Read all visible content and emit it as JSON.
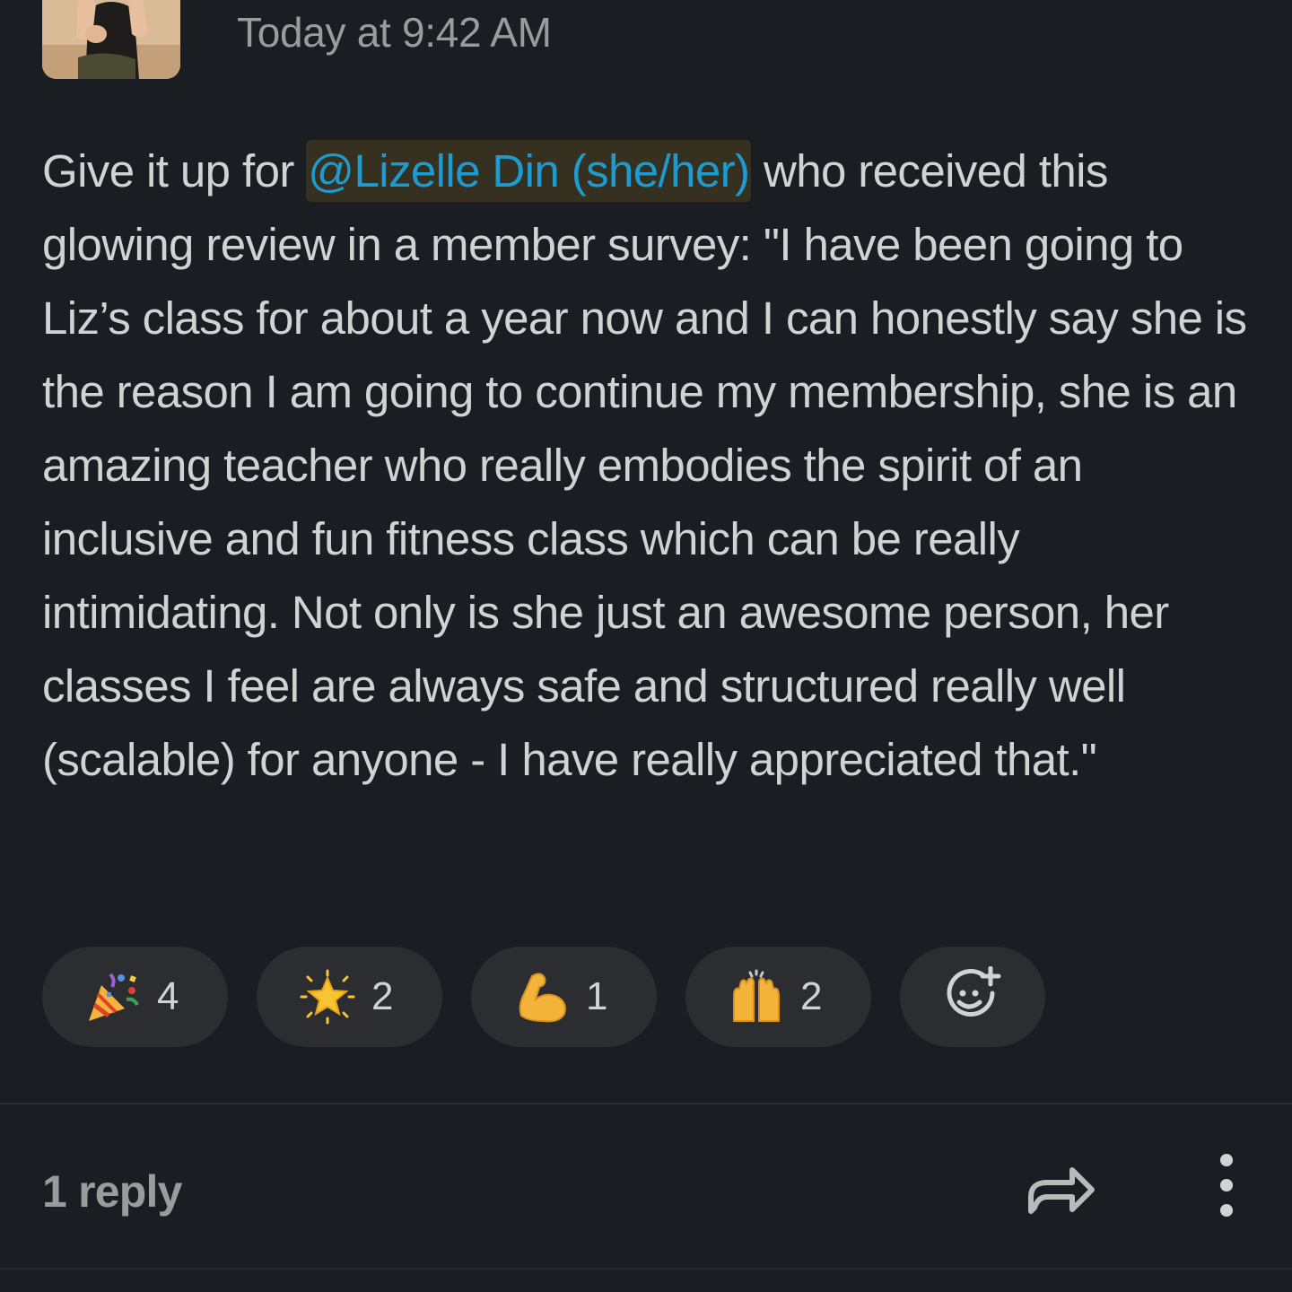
{
  "message": {
    "timestamp": "Today at 9:42 AM",
    "text_before_mention": "Give it up for ",
    "mention": "@Lizelle Din (she/her)",
    "text_after_mention": " who received this glowing review in a member survey: \"I have been going to Liz’s class for about a year now and I can honestly say she is the reason I am going to continue my membership, she is an amazing teacher who really embodies the spirit of an inclusive and fun fitness class which can be really intimidating. Not only is she just an awesome person, her classes I feel are always safe and structured really well (scalable) for anyone - I have really appreciated that.\""
  },
  "reactions": [
    {
      "icon": "party-popper-icon",
      "count": "4"
    },
    {
      "icon": "glowing-star-icon",
      "count": "2"
    },
    {
      "icon": "flexed-biceps-icon",
      "count": "1"
    },
    {
      "icon": "raising-hands-icon",
      "count": "2"
    }
  ],
  "add_reaction": {
    "icon": "add-emoji-icon"
  },
  "footer": {
    "reply_count": "1 reply",
    "share_icon": "share-arrow-icon",
    "more_icon": "more-vertical-icon"
  },
  "colors": {
    "background": "#1a1d21",
    "text": "#d1d2d3",
    "muted": "#9a9b9d",
    "mention": "#1d9bd1",
    "mention_bg": "#35301f",
    "pill": "#2c2d31"
  }
}
